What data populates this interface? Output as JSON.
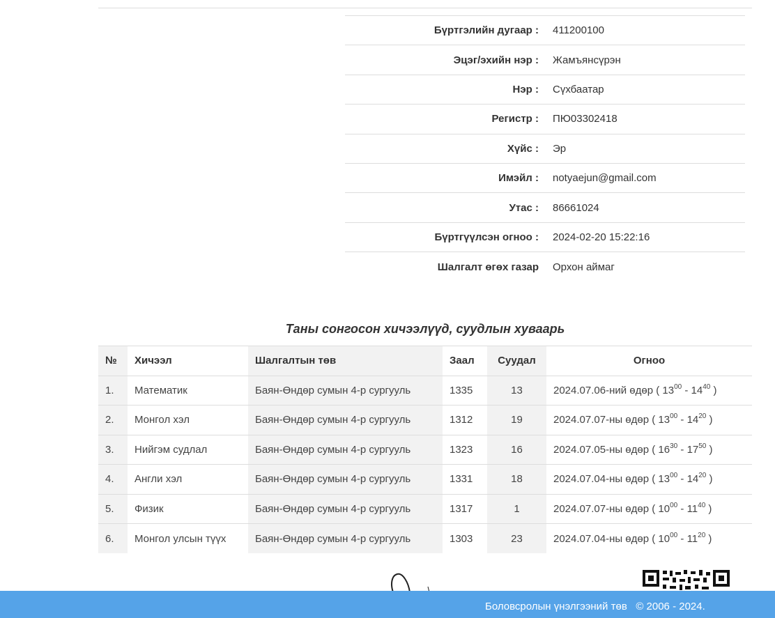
{
  "profile": {
    "rows": [
      {
        "label": "Бүртгэлийн дугаар :",
        "value": "411200100"
      },
      {
        "label": "Эцэг/эхийн нэр :",
        "value": "Жамъянсүрэн"
      },
      {
        "label": "Нэр :",
        "value": "Сүхбаатар"
      },
      {
        "label": "Регистр :",
        "value": "ПЮ03302418"
      },
      {
        "label": "Хүйс :",
        "value": "Эр"
      },
      {
        "label": "Имэйл :",
        "value": "notyaejun@gmail.com"
      },
      {
        "label": "Утас :",
        "value": "86661024"
      },
      {
        "label": "Бүртгүүлсэн огноо :",
        "value": "2024-02-20 15:22:16"
      },
      {
        "label": "Шалгалт өгөх газар",
        "value": "Орхон аймаг"
      }
    ]
  },
  "schedule": {
    "title": "Таны сонгосон хичээлүүд, суудлын хуваарь",
    "headers": {
      "no": "№",
      "subject": "Хичээл",
      "center": "Шалгалтын төв",
      "room": "Заал",
      "seat": "Суудал",
      "date": "Огноо"
    },
    "rows": [
      {
        "no": "1.",
        "subject": "Математик",
        "center": "Баян-Өндөр сумын 4-р сургууль",
        "room": "1335",
        "seat": "13",
        "date": "2024.07.06-ний өдөр ( 13",
        "t1": "00",
        "mid": " - 14",
        "t2": "40",
        "end": " )"
      },
      {
        "no": "2.",
        "subject": "Монгол хэл",
        "center": "Баян-Өндөр сумын 4-р сургууль",
        "room": "1312",
        "seat": "19",
        "date": "2024.07.07-ны өдөр ( 13",
        "t1": "00",
        "mid": " - 14",
        "t2": "20",
        "end": " )"
      },
      {
        "no": "3.",
        "subject": "Нийгэм судлал",
        "center": "Баян-Өндөр сумын 4-р сургууль",
        "room": "1323",
        "seat": "16",
        "date": "2024.07.05-ны өдөр ( 16",
        "t1": "30",
        "mid": " - 17",
        "t2": "50",
        "end": " )"
      },
      {
        "no": "4.",
        "subject": "Англи хэл",
        "center": "Баян-Өндөр сумын 4-р сургууль",
        "room": "1331",
        "seat": "18",
        "date": "2024.07.04-ны өдөр ( 13",
        "t1": "00",
        "mid": " - 14",
        "t2": "20",
        "end": " )"
      },
      {
        "no": "5.",
        "subject": "Физик",
        "center": "Баян-Өндөр сумын 4-р сургууль",
        "room": "1317",
        "seat": "1",
        "date": "2024.07.07-ны өдөр ( 10",
        "t1": "00",
        "mid": " - 11",
        "t2": "40",
        "end": " )"
      },
      {
        "no": "6.",
        "subject": "Монгол улсын түүх",
        "center": "Баян-Өндөр сумын 4-р сургууль",
        "room": "1303",
        "seat": "23",
        "date": "2024.07.04-ны өдөр ( 10",
        "t1": "00",
        "mid": " - 11",
        "t2": "20",
        "end": " )"
      }
    ]
  },
  "footer": {
    "org": "Боловсролын үнэлгээний төв",
    "copyright": "© 2006 - 2024."
  },
  "icons": {
    "signature": "signature-image",
    "qr": "qr-code-image"
  },
  "colors": {
    "footer_bg": "#55a3e8",
    "shaded_column": "#f2f2f2",
    "rule": "#dddddd"
  }
}
